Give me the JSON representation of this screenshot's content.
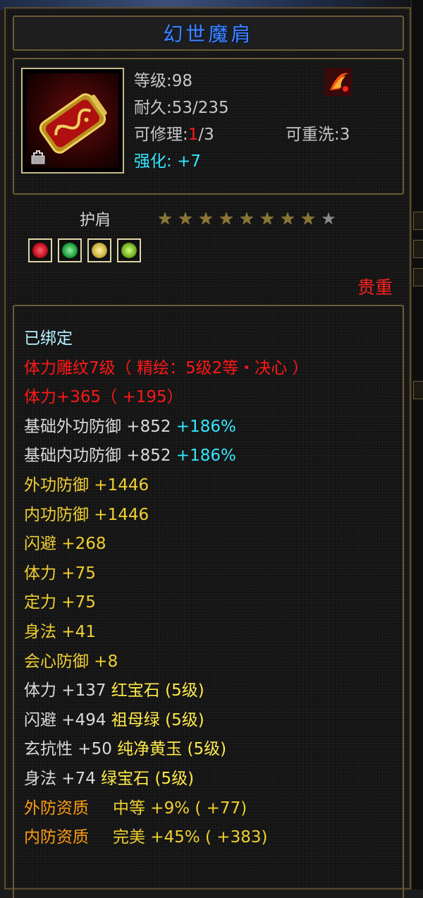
{
  "item": {
    "name": "幻世魔肩",
    "level_label": "等级:98",
    "durability_label": "耐久:53/235",
    "repair_prefix": "可修理:",
    "repair_current": "1",
    "repair_suffix": "/3",
    "rewash_label": "可重洗:3",
    "enhance_label": "强化:",
    "enhance_value": "+7",
    "slot": "护肩",
    "stars_total": 9,
    "stars_filled": 8,
    "precious_label": "贵重",
    "gems": [
      {
        "name": "red-gem",
        "color": "#d01830"
      },
      {
        "name": "green-gem",
        "color": "#20a040"
      },
      {
        "name": "yellow-gem",
        "color": "#c8b040"
      },
      {
        "name": "lime-gem",
        "color": "#70b020"
      }
    ]
  },
  "attributes": {
    "bound": "已绑定",
    "engrave": "体力雕纹7级（ 精绘：5级2等・决心 ）",
    "vitality_bonus": "体力+365（ +195）",
    "base_outer_def_label": "基础外功防御 +852",
    "base_outer_def_pct": " +186%",
    "base_inner_def_label": "基础内功防御 +852",
    "base_inner_def_pct": " +186%",
    "outer_def": "外功防御 +1446",
    "inner_def": "内功防御 +1446",
    "dodge": "闪避 +268",
    "vitality": "体力 +75",
    "focus": "定力 +75",
    "agility": "身法 +41",
    "crit_def": "会心防御 +8",
    "gem1_stat": "体力 +137 ",
    "gem1_name": "红宝石 (5级)",
    "gem2_stat": "闪避 +494 ",
    "gem2_name": "祖母绿 (5级)",
    "gem3_stat": "玄抗性 +50 ",
    "gem3_name": "纯净黄玉 (5级)",
    "gem4_stat": "身法 +74 ",
    "gem4_name": "绿宝石 (5级)",
    "outer_quality_label": "外防资质",
    "outer_quality_value": "中等 +9% ( +77)",
    "inner_quality_label": "内防资质",
    "inner_quality_value": "完美 +45% ( +383)"
  }
}
